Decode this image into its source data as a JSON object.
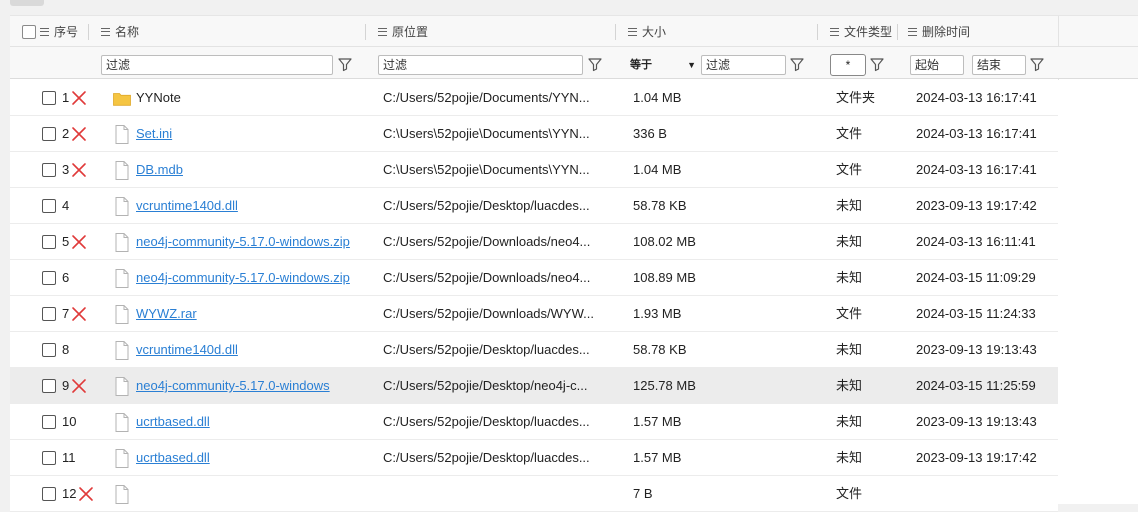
{
  "header": {
    "index": "序号",
    "name": "名称",
    "location": "原位置",
    "size": "大小",
    "type": "文件类型",
    "mtime": "删除时间"
  },
  "filters": {
    "name_placeholder": "过滤",
    "location_placeholder": "过滤",
    "size_operator": "等于",
    "size_placeholder": "过滤",
    "type_value": "*",
    "start_placeholder": "起始",
    "end_placeholder": "结束"
  },
  "colors": {
    "link": "#2a7fd4",
    "delete_mark": "#e03a3a",
    "folder": "#f5c542",
    "selected_row": "#ececec"
  },
  "rows": [
    {
      "index": "1",
      "deleted": true,
      "icon": "folder-icon",
      "name": "YYNote",
      "is_link": false,
      "location": "C:/Users/52pojie/Documents/YYN...",
      "size": "1.04 MB",
      "type": "文件夹",
      "time": "2024-03-13 16:17:41"
    },
    {
      "index": "2",
      "deleted": true,
      "icon": "file-icon",
      "name": "Set.ini",
      "is_link": true,
      "location": "C:\\Users\\52pojie\\Documents\\YYN...",
      "size": "336 B",
      "type": "文件",
      "time": "2024-03-13 16:17:41"
    },
    {
      "index": "3",
      "deleted": true,
      "icon": "file-icon",
      "name": "DB.mdb",
      "is_link": true,
      "location": "C:\\Users\\52pojie\\Documents\\YYN...",
      "size": "1.04 MB",
      "type": "文件",
      "time": "2024-03-13 16:17:41"
    },
    {
      "index": "4",
      "deleted": false,
      "icon": "file-icon",
      "name": "vcruntime140d.dll",
      "is_link": true,
      "location": "C:/Users/52pojie/Desktop/luacdes...",
      "size": "58.78 KB",
      "type": "未知",
      "time": "2023-09-13 19:17:42"
    },
    {
      "index": "5",
      "deleted": true,
      "icon": "file-icon",
      "name": "neo4j-community-5.17.0-windows.zip",
      "is_link": true,
      "location": "C:/Users/52pojie/Downloads/neo4...",
      "size": "108.02 MB",
      "type": "未知",
      "time": "2024-03-13 16:11:41"
    },
    {
      "index": "6",
      "deleted": false,
      "icon": "file-icon",
      "name": "neo4j-community-5.17.0-windows.zip",
      "is_link": true,
      "location": "C:/Users/52pojie/Downloads/neo4...",
      "size": "108.89 MB",
      "type": "未知",
      "time": "2024-03-15 11:09:29"
    },
    {
      "index": "7",
      "deleted": true,
      "icon": "file-icon",
      "name": "WYWZ.rar",
      "is_link": true,
      "location": "C:/Users/52pojie/Downloads/WYW...",
      "size": "1.93 MB",
      "type": "文件",
      "time": "2024-03-15 11:24:33"
    },
    {
      "index": "8",
      "deleted": false,
      "icon": "file-icon",
      "name": "vcruntime140d.dll",
      "is_link": true,
      "location": "C:/Users/52pojie/Desktop/luacdes...",
      "size": "58.78 KB",
      "type": "未知",
      "time": "2023-09-13 19:13:43"
    },
    {
      "index": "9",
      "deleted": true,
      "icon": "file-icon",
      "name": "neo4j-community-5.17.0-windows",
      "is_link": true,
      "location": "C:/Users/52pojie/Desktop/neo4j-c...",
      "size": "125.78 MB",
      "type": "未知",
      "time": "2024-03-15 11:25:59",
      "selected": true
    },
    {
      "index": "10",
      "deleted": false,
      "icon": "file-icon",
      "name": "ucrtbased.dll",
      "is_link": true,
      "location": "C:/Users/52pojie/Desktop/luacdes...",
      "size": "1.57 MB",
      "type": "未知",
      "time": "2023-09-13 19:13:43"
    },
    {
      "index": "11",
      "deleted": false,
      "icon": "file-icon",
      "name": "ucrtbased.dll",
      "is_link": true,
      "location": "C:/Users/52pojie/Desktop/luacdes...",
      "size": "1.57 MB",
      "type": "未知",
      "time": "2023-09-13 19:17:42"
    },
    {
      "index": "12",
      "deleted": true,
      "icon": "file-icon",
      "name": "",
      "is_link": true,
      "location": "",
      "size": "7 B",
      "type": "文件",
      "time": ""
    }
  ]
}
